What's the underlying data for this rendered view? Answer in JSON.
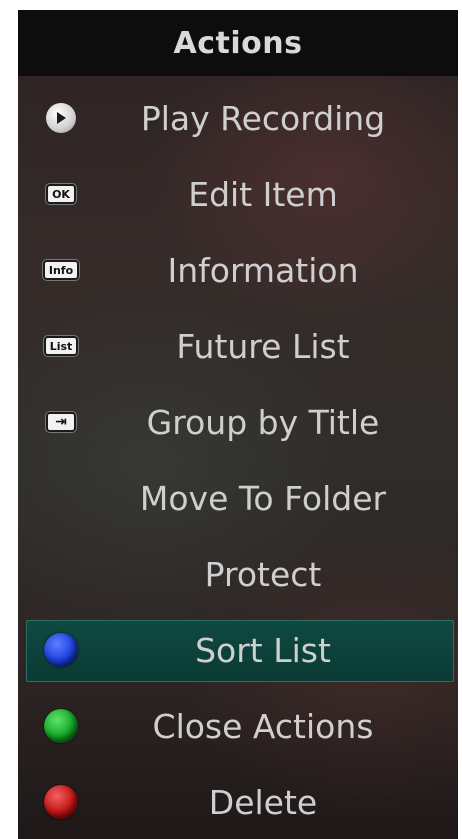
{
  "header": {
    "title": "Actions"
  },
  "items": [
    {
      "label": "Play Recording",
      "icon": "play-icon"
    },
    {
      "label": "Edit Item",
      "icon": "ok-key-icon",
      "badge": "OK"
    },
    {
      "label": "Information",
      "icon": "info-key-icon",
      "badge": "Info"
    },
    {
      "label": "Future List",
      "icon": "list-key-icon",
      "badge": "List"
    },
    {
      "label": "Group by Title",
      "icon": "tab-key-icon",
      "badge": "⇥"
    },
    {
      "label": "Move To Folder",
      "icon": null
    },
    {
      "label": "Protect",
      "icon": null
    },
    {
      "label": "Sort List",
      "icon": "blue-button-icon",
      "selected": true
    },
    {
      "label": "Close Actions",
      "icon": "green-button-icon"
    },
    {
      "label": "Delete",
      "icon": "red-button-icon"
    }
  ],
  "colors": {
    "blue": "#1e3fe0",
    "green": "#13a623",
    "red": "#c21414",
    "selected_bg": "#0f4a42"
  }
}
